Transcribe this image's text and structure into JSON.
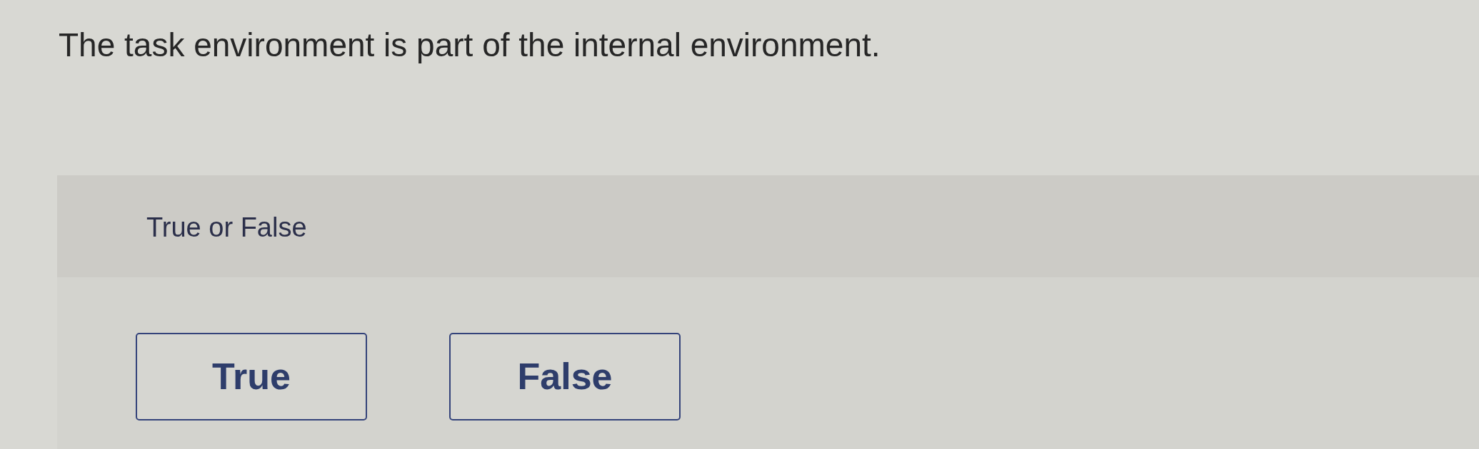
{
  "question": "The task environment is part of the internal environment.",
  "panel": {
    "prompt": "True or False",
    "options": [
      {
        "label": "True",
        "selected": false
      },
      {
        "label": "False",
        "selected": false
      }
    ]
  }
}
